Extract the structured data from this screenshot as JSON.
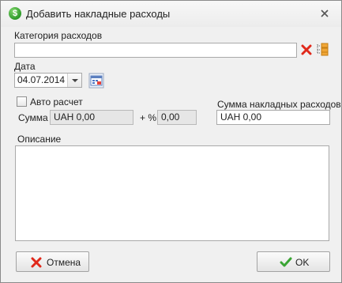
{
  "window": {
    "title": "Добавить накладные расходы"
  },
  "category": {
    "label": "Категория расходов",
    "value": ""
  },
  "date": {
    "label": "Дата",
    "value": "04.07.2014"
  },
  "auto_calc": {
    "label": "Авто расчет",
    "checked": false
  },
  "sum": {
    "label": "Сумма",
    "value": "UAH 0,00"
  },
  "percent": {
    "label": "+ %",
    "value": "0,00"
  },
  "overhead_total": {
    "label": "Сумма накладных расходов",
    "value": "UAH 0,00"
  },
  "description": {
    "label": "Описание",
    "value": ""
  },
  "buttons": {
    "cancel": "Отмена",
    "ok": "OK"
  },
  "icons": {
    "app": "dollar-coin-icon",
    "close": "close-icon",
    "clear": "clear-red-x-icon",
    "browse": "folder-tree-icon",
    "calendar": "calendar-icon",
    "cancel": "red-x-icon",
    "ok": "green-check-icon"
  },
  "colors": {
    "clear_red": "#e0281a",
    "ok_green": "#3aa534",
    "app_green": "#2e9a2a"
  }
}
